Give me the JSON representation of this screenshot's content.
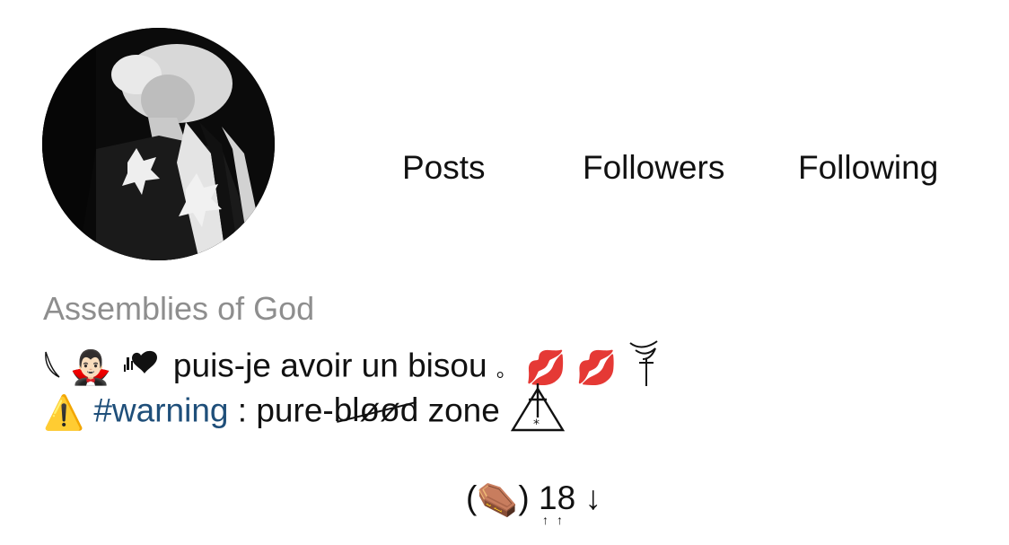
{
  "profile": {
    "avatar_icon": "profile-photo",
    "name": "Assemblies of God"
  },
  "stats": {
    "posts_label": "Posts",
    "followers_label": "Followers",
    "following_label": "Following"
  },
  "bio": {
    "line1": {
      "leaf_icon": "leaf-sliver-icon",
      "vampire_emoji": "🧛🏻‍♂️",
      "broken_heart_icon": "dripping-heart-icon",
      "text": "puis-je avoir un bisou",
      "small_circle": "。",
      "kiss_emoji": "💋",
      "kiss_emoji_2": "💋",
      "ornament_icon": "swirl-ornament-icon"
    },
    "line2": {
      "warning_emoji": "⚠️",
      "hashtag": "#warning",
      "text_before": " : pure-",
      "struck_word": "bløød",
      "text_after": " zone",
      "triangle_icon": "triangle-cross-icon"
    }
  },
  "footer": {
    "open_paren": "(",
    "coffin_emoji": "⚰️",
    "close_paren": ")",
    "number": "18",
    "tick_arrows": "↑↑",
    "down_arrow": "↓"
  },
  "colors": {
    "name_gray": "#8e8e8e",
    "hashtag_blue": "#1f4f7a",
    "text": "#111111",
    "background": "#ffffff"
  }
}
